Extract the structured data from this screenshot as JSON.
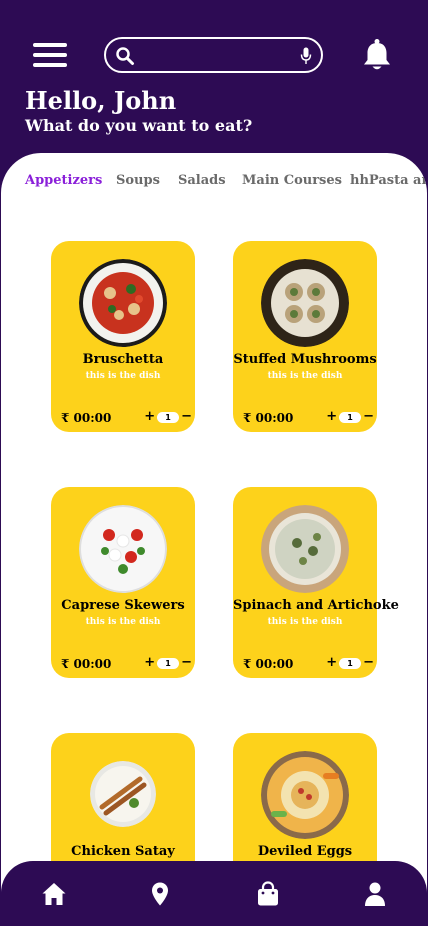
{
  "header": {
    "greeting": "Hello, John",
    "subtitle": "What do you want to eat?",
    "search_placeholder": "",
    "icons": {
      "menu": "hamburger-icon",
      "search": "search-icon",
      "mic": "microphone-icon",
      "notifications": "bell-icon"
    }
  },
  "categories": [
    "Appetizers",
    "Soups",
    "Salads",
    "Main Courses",
    "hhPasta and"
  ],
  "active_category": "Appetizers",
  "dishes": [
    {
      "name": "Bruschetta",
      "description": "this is the dish",
      "price": "00:00",
      "quantity": "1"
    },
    {
      "name": "Stuffed Mushrooms",
      "description": "this is the dish",
      "price": "00:00",
      "quantity": "1"
    },
    {
      "name": "Caprese Skewers",
      "description": "this is the dish",
      "price": "00:00",
      "quantity": "1"
    },
    {
      "name": "Spinach and Artichoke",
      "description": "this is the dish",
      "price": "00:00",
      "quantity": "1"
    },
    {
      "name": "Chicken Satay",
      "description": "",
      "price": "",
      "quantity": ""
    },
    {
      "name": "Deviled Eggs",
      "description": "",
      "price": "",
      "quantity": ""
    }
  ],
  "currency_symbol": "₹",
  "qty_controls": {
    "plus": "+",
    "minus": "−"
  },
  "bottom_nav": {
    "icons": [
      "home-icon",
      "location-pin-icon",
      "shopping-bag-icon",
      "user-icon"
    ]
  },
  "colors": {
    "primary": "#2d0b54",
    "card": "#fdd21b",
    "active_tab": "#8a1fd9",
    "inactive_tab": "#6a6a6a"
  }
}
